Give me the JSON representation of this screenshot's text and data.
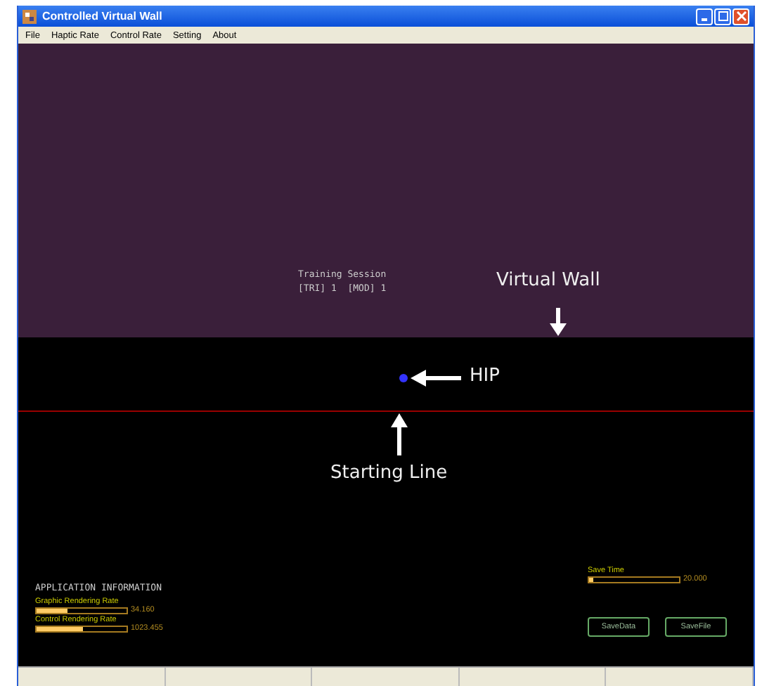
{
  "window": {
    "title": "Controlled Virtual Wall"
  },
  "menu": [
    "File",
    "Haptic Rate",
    "Control Rate",
    "Setting",
    "About"
  ],
  "scene": {
    "session_title": "Training Session",
    "session_info": "[TRI] 1  [MOD] 1",
    "wall_label": "Virtual Wall",
    "hip_label": "HIP",
    "start_label": "Starting Line"
  },
  "app_info": {
    "title": "APPLICATION INFORMATION",
    "meters": [
      {
        "label": "Graphic Rendering Rate",
        "level": 0.35,
        "reading": "34.160"
      },
      {
        "label": "Control Rendering Rate",
        "level": 0.52,
        "reading": "1023.455"
      }
    ]
  },
  "save_time": {
    "label": "Save Time",
    "level": 0.05,
    "reading": "20.000"
  },
  "buttons": [
    "SaveData",
    "SaveFile"
  ]
}
